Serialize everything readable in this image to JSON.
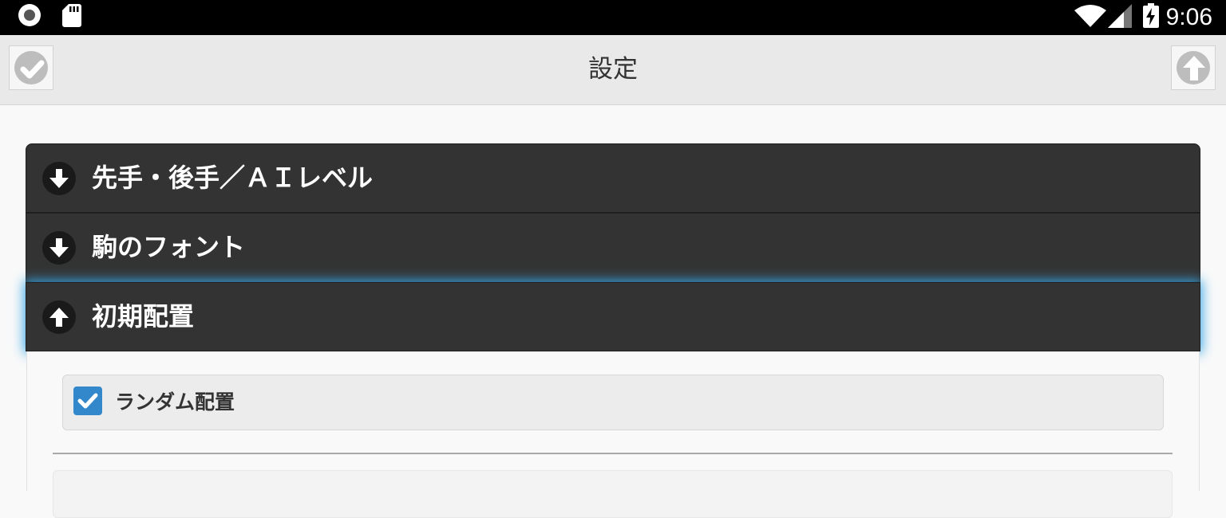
{
  "status_bar": {
    "time": "9:06",
    "icons": [
      "record-icon",
      "sd-card-icon",
      "wifi-icon",
      "signal-icon",
      "battery-charging-icon"
    ]
  },
  "header": {
    "title": "設定",
    "left_button_icon": "check-icon",
    "right_button_icon": "arrow-up-icon"
  },
  "sections": [
    {
      "title": "先手・後手／ＡＩレベル",
      "icon": "arrow-down-icon",
      "expanded": false
    },
    {
      "title": "駒のフォント",
      "icon": "arrow-down-icon",
      "expanded": false
    },
    {
      "title": "初期配置",
      "icon": "arrow-up-icon",
      "expanded": true
    }
  ],
  "content": {
    "random_placement": {
      "label": "ランダム配置",
      "checked": true
    }
  },
  "colors": {
    "section_bg": "#333333",
    "focus_glow": "#3aa8e8",
    "checkbox_accent": "#3388cc",
    "header_bg": "#e9e9e9"
  }
}
